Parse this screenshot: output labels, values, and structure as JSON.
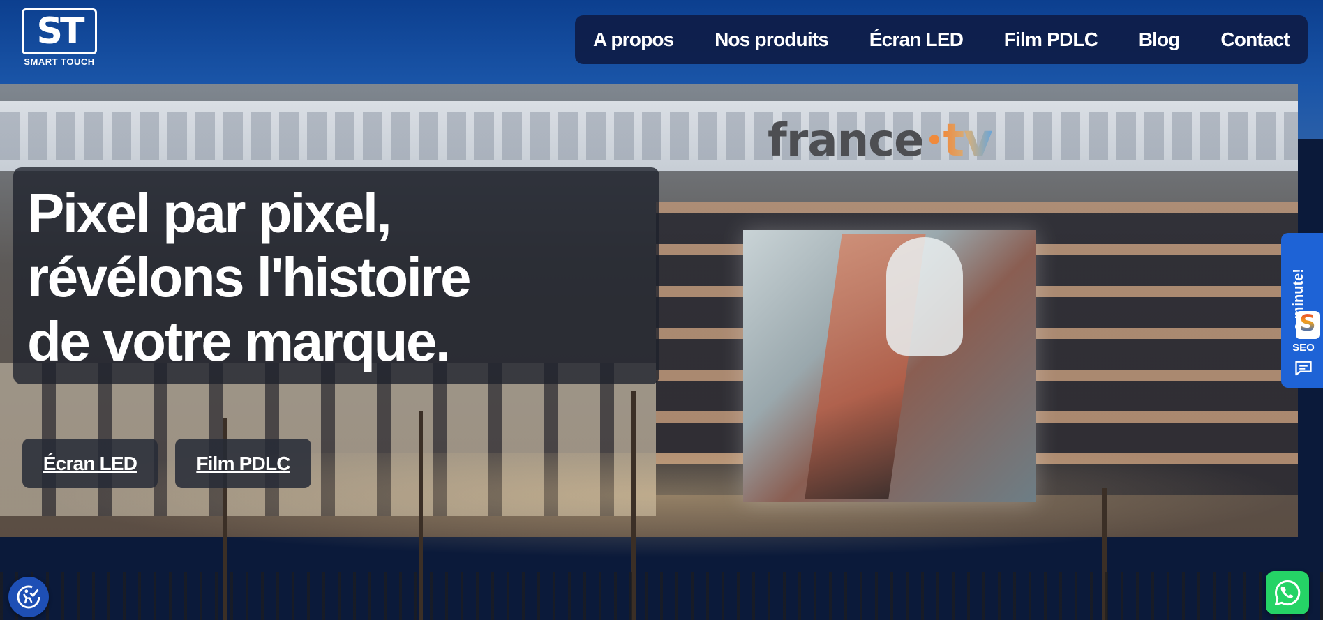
{
  "header": {
    "logo": {
      "monogram": "ST",
      "wordmark": "SMART TOUCH"
    },
    "nav": [
      {
        "label": "A propos"
      },
      {
        "label": "Nos produits"
      },
      {
        "label": "Écran LED"
      },
      {
        "label": "Film PDLC"
      },
      {
        "label": "Blog"
      },
      {
        "label": "Contact"
      }
    ]
  },
  "background": {
    "building_sign_main": "france",
    "building_sign_suffix": "tv"
  },
  "hero": {
    "title_lines": [
      "Pixel par pixel,",
      "révélons l'histoire",
      "de votre marque."
    ],
    "buttons": [
      {
        "label": "Écran LED"
      },
      {
        "label": "Film PDLC"
      }
    ]
  },
  "side_widget": {
    "text": "s minute!",
    "badge_letter": "S",
    "badge_label": "SEO",
    "chat_icon": "chat-icon",
    "color": "#1e63d6"
  },
  "floating": {
    "accessibility_icon": "accessibility-icon",
    "whatsapp_icon": "whatsapp-icon",
    "whatsapp_color": "#25d366",
    "accessibility_color": "#1e4fb5"
  },
  "colors": {
    "nav_bg": "#0e1c46",
    "hero_card_bg": "#1e212c"
  }
}
